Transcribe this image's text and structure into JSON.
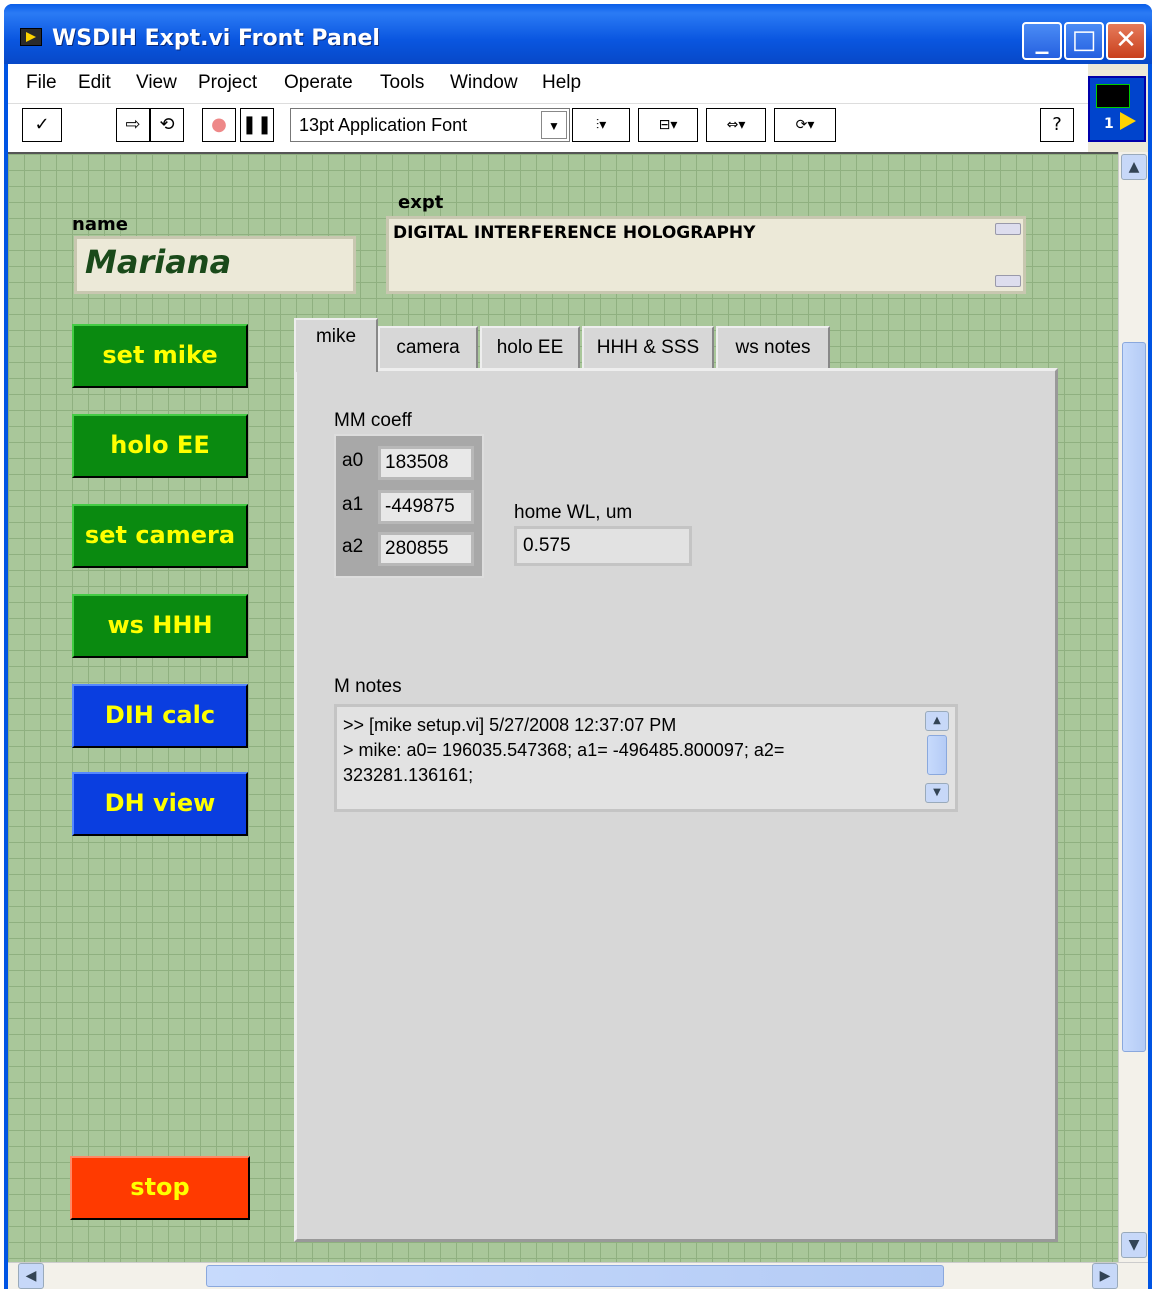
{
  "window": {
    "title": "WSDIH Expt.vi Front Panel"
  },
  "menu": [
    "File",
    "Edit",
    "View",
    "Project",
    "Operate",
    "Tools",
    "Window",
    "Help"
  ],
  "toolbar": {
    "font": "13pt Application Font",
    "vi_number": "1"
  },
  "controls": {
    "name_label": "name",
    "name_value": "Mariana",
    "expt_label": "expt",
    "expt_value": "DIGITAL INTERFERENCE HOLOGRAPHY"
  },
  "buttons": [
    "set mike",
    "holo EE",
    "set camera",
    "ws HHH",
    "DIH calc",
    "DH view",
    "stop"
  ],
  "tabs": {
    "labels": [
      "mike",
      "camera",
      "holo EE",
      "HHH & SSS",
      "ws notes"
    ],
    "active": "mike"
  },
  "mike_tab": {
    "coeff_label": "MM coeff",
    "coeffs": [
      {
        "name": "a0",
        "value": "183508"
      },
      {
        "name": "a1",
        "value": "-449875"
      },
      {
        "name": "a2",
        "value": "280855"
      }
    ],
    "home_label": "home WL, um",
    "home_value": "0.575",
    "notes_label": "M notes",
    "notes_text": ">> [mike setup.vi] 5/27/2008 12:37:07 PM\n> mike: a0= 196035.547368; a1= -496485.800097; a2=\n323281.136161;"
  },
  "colors": {
    "panel_bg": "#a9c79a",
    "green_button": "#0a8a10",
    "blue_button": "#0a3ee0",
    "stop_button": "#ff3a00",
    "button_text": "#ffff00"
  }
}
